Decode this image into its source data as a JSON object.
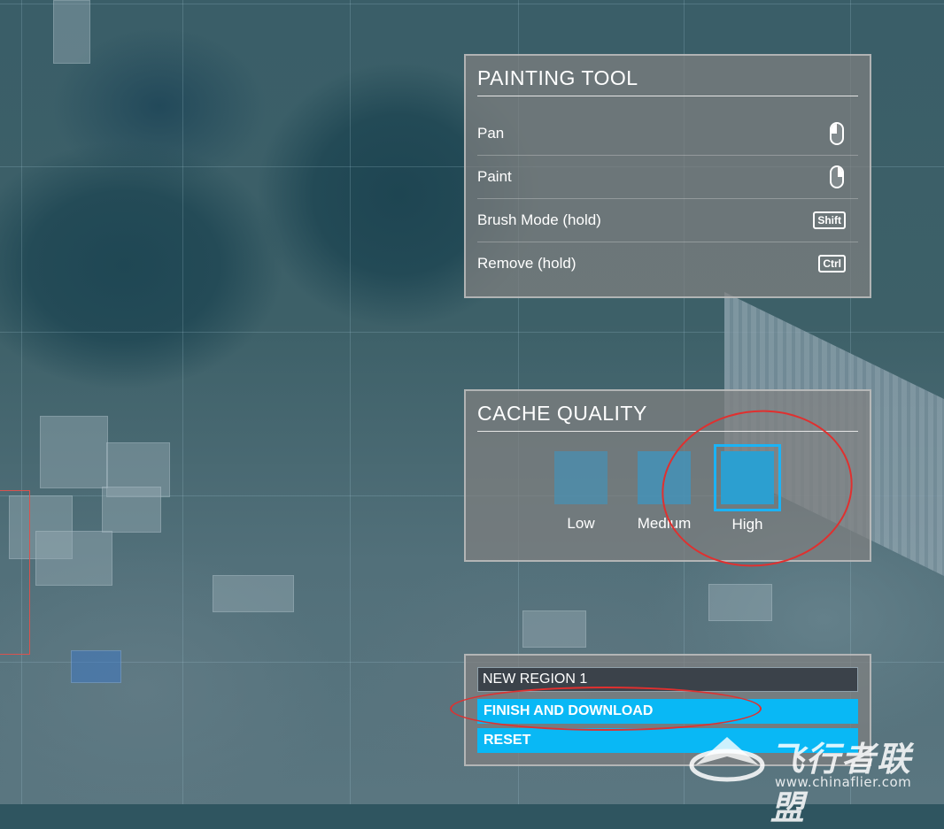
{
  "painting_tool": {
    "title": "PAINTING TOOL",
    "rows": [
      {
        "label": "Pan",
        "icon": "mouse-left-click-icon"
      },
      {
        "label": "Paint",
        "icon": "mouse-right-click-icon"
      },
      {
        "label": "Brush Mode (hold)",
        "key": "Shift"
      },
      {
        "label": "Remove (hold)",
        "key": "Ctrl"
      }
    ]
  },
  "cache_quality": {
    "title": "CACHE QUALITY",
    "options": [
      {
        "label": "Low",
        "selected": false
      },
      {
        "label": "Medium",
        "selected": false
      },
      {
        "label": "High",
        "selected": true
      }
    ]
  },
  "region": {
    "name_value": "NEW REGION 1",
    "finish_label": "FINISH AND DOWNLOAD",
    "reset_label": "RESET"
  },
  "watermark": {
    "text": "飞行者联盟",
    "url": "www.chinaflier.com"
  },
  "colors": {
    "accent": "#09b8f5",
    "selection_border": "#1bb3f5",
    "annotation": "#e0302f"
  }
}
